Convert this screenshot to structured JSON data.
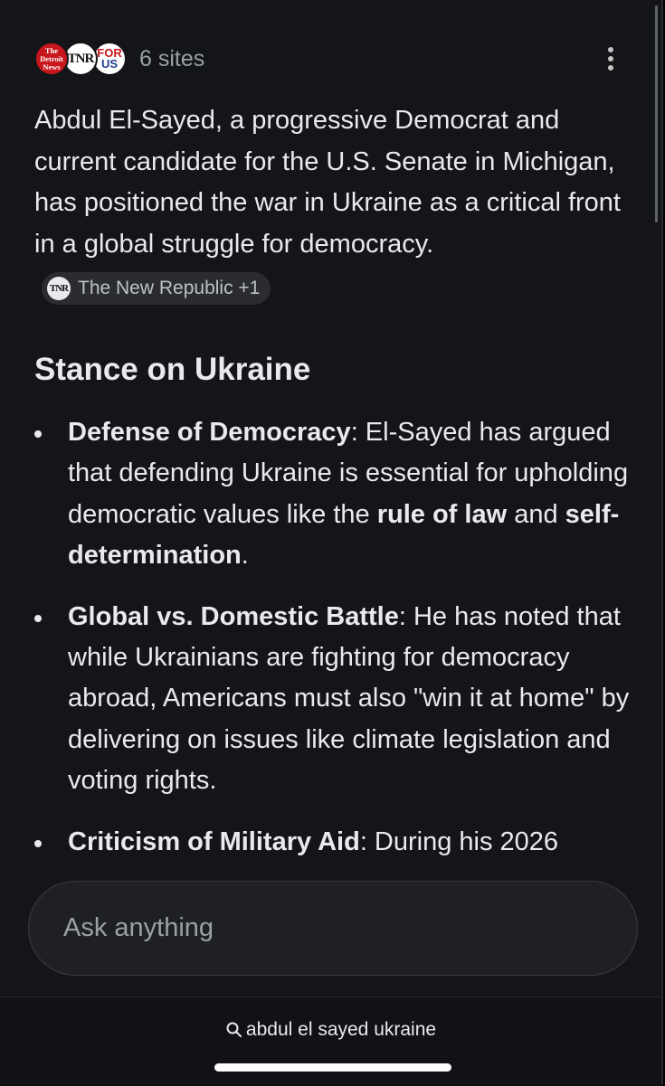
{
  "sources": {
    "favicons": [
      {
        "name": "The Detroit News",
        "glyph_lines": [
          "The",
          "Detroit",
          "News"
        ]
      },
      {
        "name": "The New Republic",
        "glyph": "TNR"
      },
      {
        "name": "For Our Future",
        "glyph_top": "FOR",
        "glyph_bottom": "US"
      }
    ],
    "count_label": "6 sites"
  },
  "summary": {
    "text": "Abdul El-Sayed, a progressive Democrat and current candidate for the U.S. Senate in Michigan, has positioned the war in Ukraine as a critical front in a global struggle for democracy.",
    "citation_chip": {
      "icon": "TNR",
      "label": "The New Republic +1"
    }
  },
  "section": {
    "title": "Stance on Ukraine",
    "bullets": [
      {
        "lead": "Defense of Democracy",
        "text_1": ": El-Sayed has argued that defending Ukraine is essential for upholding democratic values like the ",
        "bold_1": "rule of law",
        "text_2": " and ",
        "bold_2": "self-determination",
        "text_3": "."
      },
      {
        "lead": "Global vs. Domestic Battle",
        "text": ": He has noted that while Ukrainians are fighting for democracy abroad, Americans must also \"win it at home\" by delivering on issues like climate legislation and voting rights."
      },
      {
        "lead": "Criticism of Military Aid",
        "text": ": During his 2026"
      }
    ]
  },
  "input": {
    "placeholder": "Ask anything",
    "value": ""
  },
  "bottom_bar": {
    "query": "abdul el sayed ukraine",
    "icon": "search-icon"
  },
  "colors": {
    "background": "#141518",
    "text": "#e8eaed",
    "muted": "#9aa0a6",
    "chip": "#2b2c30",
    "input_bg": "#1f2024"
  }
}
